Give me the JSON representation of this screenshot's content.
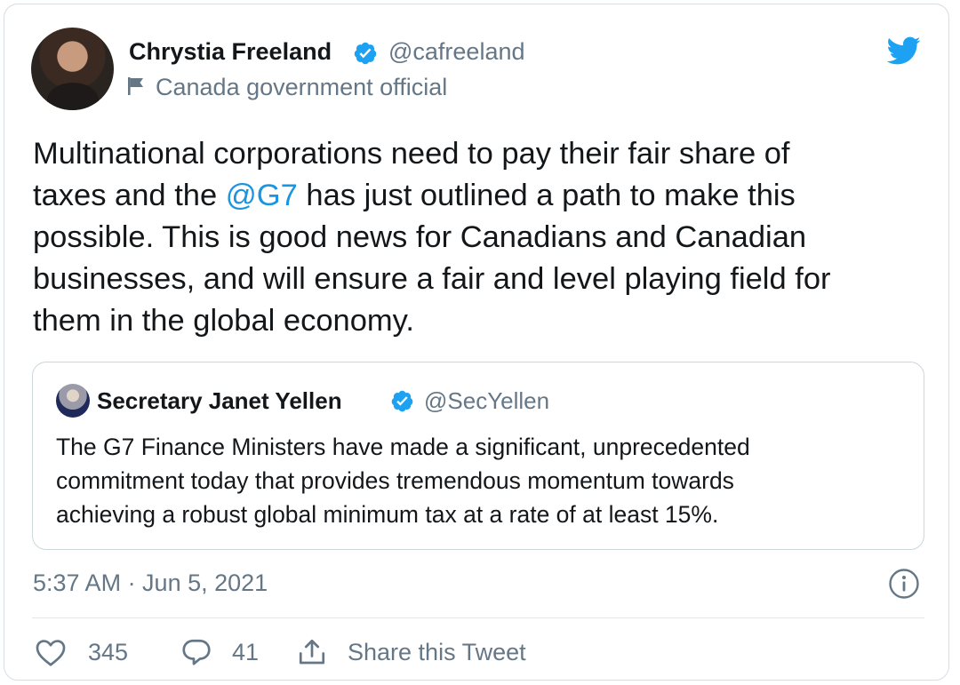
{
  "author": {
    "name": "Chrystia Freeland",
    "handle": "@cafreeland",
    "label": "Canada government official",
    "verified": true
  },
  "tweet": {
    "lines": [
      {
        "before": "Multinational corporations need to pay their fair share of",
        "mention": "",
        "after": ""
      },
      {
        "before": "taxes and the ",
        "mention": "@G7",
        "after": " has just outlined a path to make this"
      },
      {
        "before": "possible. This is good news for Canadians and Canadian",
        "mention": "",
        "after": ""
      },
      {
        "before": "businesses, and will ensure a fair and level playing field for",
        "mention": "",
        "after": ""
      },
      {
        "before": "them in the global economy.",
        "mention": "",
        "after": ""
      }
    ]
  },
  "quoted": {
    "name": "Secretary Janet Yellen",
    "handle": "@SecYellen",
    "verified": true,
    "lines": [
      "The G7 Finance Ministers have made a significant, unprecedented",
      "commitment today that provides tremendous momentum towards",
      "achieving a robust global minimum tax at a rate of at least 15%."
    ]
  },
  "timestamp": "5:37 AM · Jun 5, 2021",
  "actions": {
    "likes": "345",
    "replies": "41",
    "share_label": "Share this Tweet"
  },
  "colors": {
    "brand": "#1da1f2",
    "mention": "#1b95e0",
    "secondary_text": "#657786"
  },
  "icons": [
    "twitter-bird-icon",
    "verified-badge-icon",
    "flag-icon",
    "info-icon",
    "heart-icon",
    "reply-bubble-icon",
    "share-icon"
  ]
}
